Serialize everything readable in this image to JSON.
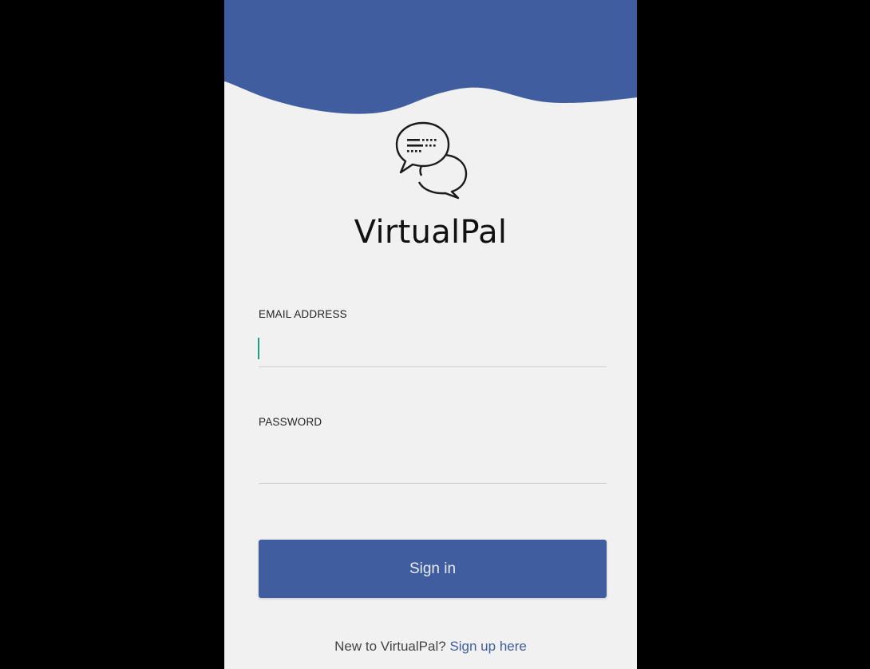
{
  "app": {
    "title": "VirtualPal",
    "brand_color": "#3f5d9f",
    "accent_color": "#1b9e84"
  },
  "logo": {
    "icon": "chat-bubbles-icon"
  },
  "form": {
    "email": {
      "label": "EMAIL ADDRESS",
      "value": "",
      "focused": true
    },
    "password": {
      "label": "PASSWORD",
      "value": ""
    },
    "submit_label": "Sign in"
  },
  "footer": {
    "prompt": "New to VirtualPal?",
    "link_label": "Sign up here"
  }
}
